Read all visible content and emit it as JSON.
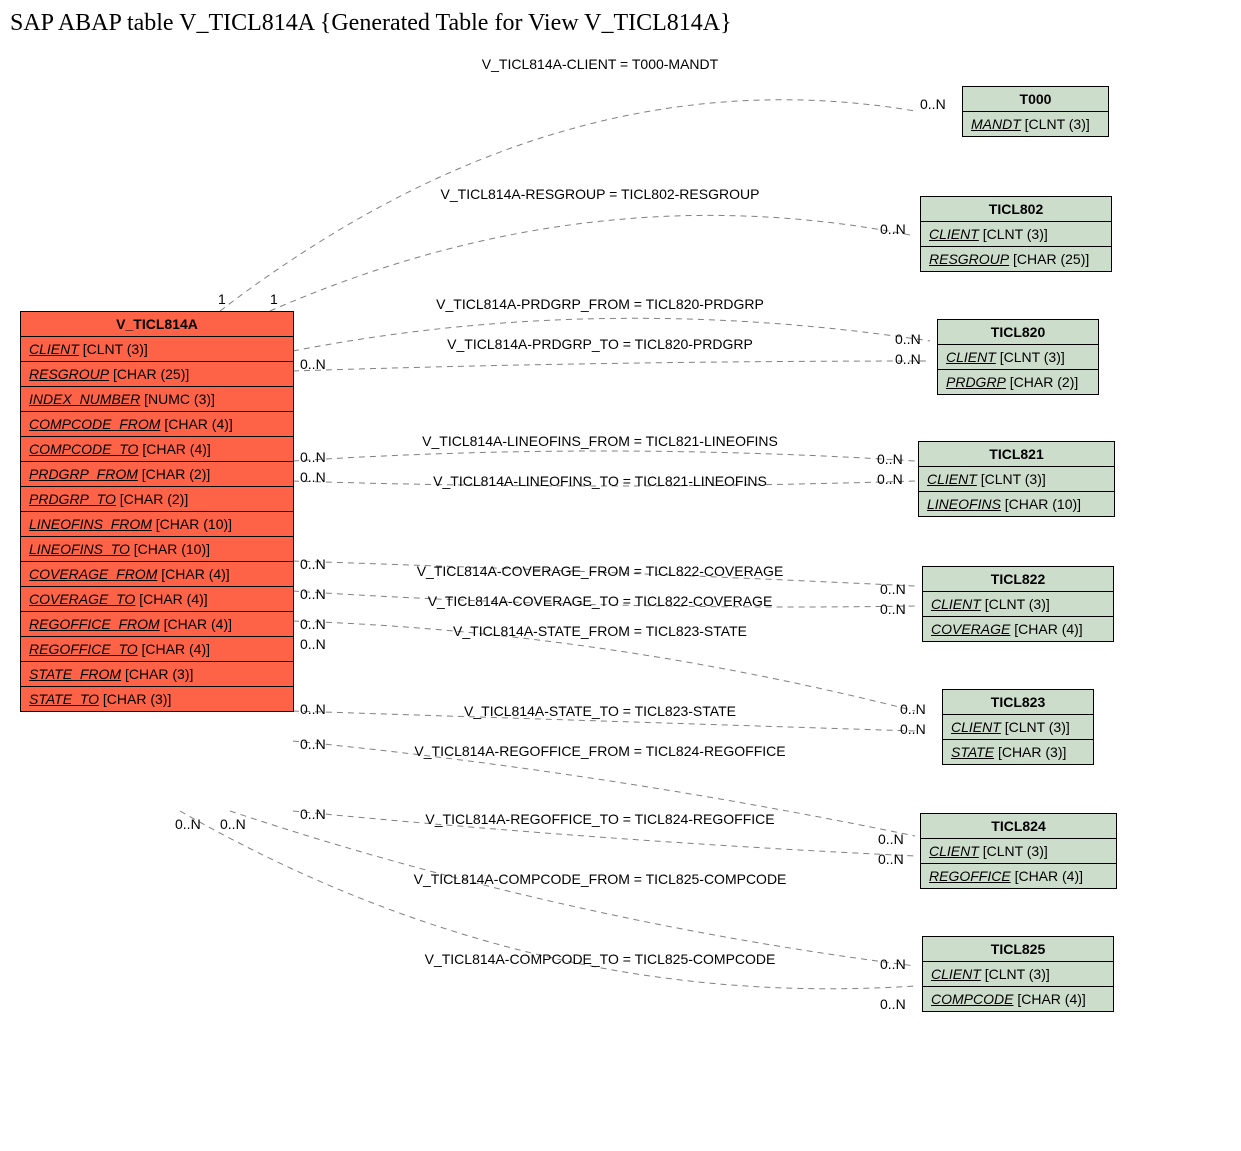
{
  "title": "SAP ABAP table V_TICL814A {Generated Table for View V_TICL814A}",
  "main_entity": {
    "name": "V_TICL814A",
    "fields": [
      {
        "f": "CLIENT",
        "t": "[CLNT (3)]"
      },
      {
        "f": "RESGROUP",
        "t": "[CHAR (25)]"
      },
      {
        "f": "INDEX_NUMBER",
        "t": "[NUMC (3)]"
      },
      {
        "f": "COMPCODE_FROM",
        "t": "[CHAR (4)]"
      },
      {
        "f": "COMPCODE_TO",
        "t": "[CHAR (4)]"
      },
      {
        "f": "PRDGRP_FROM",
        "t": "[CHAR (2)]"
      },
      {
        "f": "PRDGRP_TO",
        "t": "[CHAR (2)]"
      },
      {
        "f": "LINEOFINS_FROM",
        "t": "[CHAR (10)]"
      },
      {
        "f": "LINEOFINS_TO",
        "t": "[CHAR (10)]"
      },
      {
        "f": "COVERAGE_FROM",
        "t": "[CHAR (4)]"
      },
      {
        "f": "COVERAGE_TO",
        "t": "[CHAR (4)]"
      },
      {
        "f": "REGOFFICE_FROM",
        "t": "[CHAR (4)]"
      },
      {
        "f": "REGOFFICE_TO",
        "t": "[CHAR (4)]"
      },
      {
        "f": "STATE_FROM",
        "t": "[CHAR (3)]"
      },
      {
        "f": "STATE_TO",
        "t": "[CHAR (3)]"
      }
    ]
  },
  "targets": [
    {
      "name": "T000",
      "fields": [
        {
          "f": "MANDT",
          "t": "[CLNT (3)]"
        }
      ]
    },
    {
      "name": "TICL802",
      "fields": [
        {
          "f": "CLIENT",
          "t": "[CLNT (3)]"
        },
        {
          "f": "RESGROUP",
          "t": "[CHAR (25)]"
        }
      ]
    },
    {
      "name": "TICL820",
      "fields": [
        {
          "f": "CLIENT",
          "t": "[CLNT (3)]"
        },
        {
          "f": "PRDGRP",
          "t": "[CHAR (2)]"
        }
      ]
    },
    {
      "name": "TICL821",
      "fields": [
        {
          "f": "CLIENT",
          "t": "[CLNT (3)]"
        },
        {
          "f": "LINEOFINS",
          "t": "[CHAR (10)]"
        }
      ]
    },
    {
      "name": "TICL822",
      "fields": [
        {
          "f": "CLIENT",
          "t": "[CLNT (3)]"
        },
        {
          "f": "COVERAGE",
          "t": "[CHAR (4)]"
        }
      ]
    },
    {
      "name": "TICL823",
      "fields": [
        {
          "f": "CLIENT",
          "t": "[CLNT (3)]"
        },
        {
          "f": "STATE",
          "t": "[CHAR (3)]"
        }
      ]
    },
    {
      "name": "TICL824",
      "fields": [
        {
          "f": "CLIENT",
          "t": "[CLNT (3)]"
        },
        {
          "f": "REGOFFICE",
          "t": "[CHAR (4)]"
        }
      ]
    },
    {
      "name": "TICL825",
      "fields": [
        {
          "f": "CLIENT",
          "t": "[CLNT (3)]"
        },
        {
          "f": "COMPCODE",
          "t": "[CHAR (4)]"
        }
      ]
    }
  ],
  "relations": [
    "V_TICL814A-CLIENT = T000-MANDT",
    "V_TICL814A-RESGROUP = TICL802-RESGROUP",
    "V_TICL814A-PRDGRP_FROM = TICL820-PRDGRP",
    "V_TICL814A-PRDGRP_TO = TICL820-PRDGRP",
    "V_TICL814A-LINEOFINS_FROM = TICL821-LINEOFINS",
    "V_TICL814A-LINEOFINS_TO = TICL821-LINEOFINS",
    "V_TICL814A-COVERAGE_FROM = TICL822-COVERAGE",
    "V_TICL814A-COVERAGE_TO = TICL822-COVERAGE",
    "V_TICL814A-STATE_FROM = TICL823-STATE",
    "V_TICL814A-STATE_TO = TICL823-STATE",
    "V_TICL814A-REGOFFICE_FROM = TICL824-REGOFFICE",
    "V_TICL814A-REGOFFICE_TO = TICL824-REGOFFICE",
    "V_TICL814A-COMPCODE_FROM = TICL825-COMPCODE",
    "V_TICL814A-COMPCODE_TO = TICL825-COMPCODE"
  ],
  "card_1": "1",
  "card_0n": "0..N"
}
